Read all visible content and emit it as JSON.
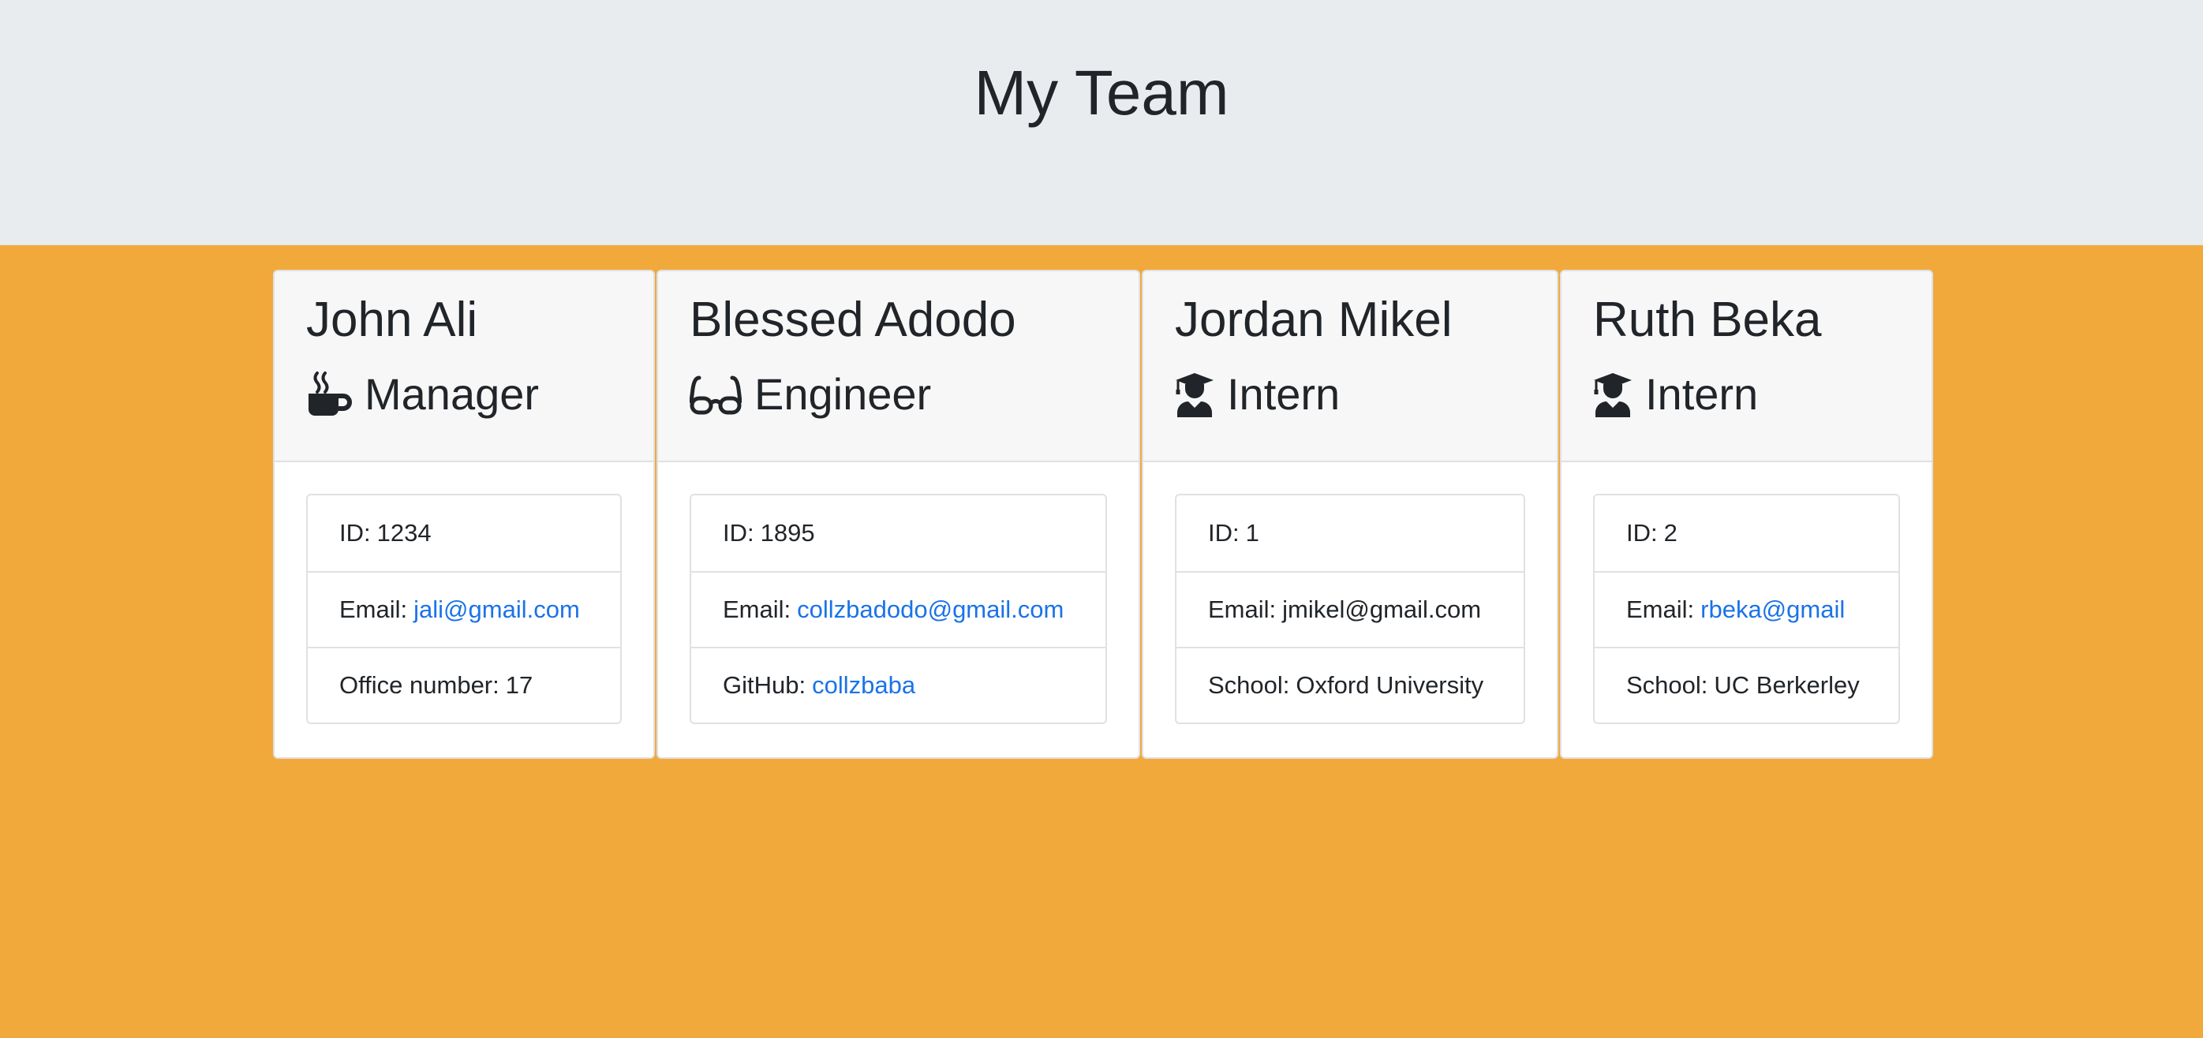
{
  "page": {
    "title": "My Team",
    "colors": {
      "header_bg": "#e9ecef",
      "body_bg": "#f2a93b",
      "link": "#1a73e8"
    }
  },
  "cards": [
    {
      "name": "John Ali",
      "role": "Manager",
      "role_icon": "coffee-mug-icon",
      "id_label": "ID:",
      "id_value": "1234",
      "email_label": "Email:",
      "email_value": "jali@gmail.com",
      "extra_label": "Office number:",
      "extra_value": "17"
    },
    {
      "name": "Blessed Adodo",
      "role": "Engineer",
      "role_icon": "glasses-icon",
      "id_label": "ID:",
      "id_value": "1895",
      "email_label": "Email:",
      "email_value": "collzbadodo@gmail.com",
      "extra_label": "GitHub:",
      "extra_value": "collzbaba"
    },
    {
      "name": "Jordan Mikel",
      "role": "Intern",
      "role_icon": "graduate-icon",
      "id_label": "ID:",
      "id_value": "1",
      "email_label": "Email:",
      "email_value": "jmikel@gmail.com",
      "extra_label": "School:",
      "extra_value": "Oxford University"
    },
    {
      "name": "Ruth Beka",
      "role": "Intern",
      "role_icon": "graduate-icon",
      "id_label": "ID:",
      "id_value": "2",
      "email_label": "Email:",
      "email_value": "rbeka@gmail",
      "extra_label": "School:",
      "extra_value": "UC Berkerley"
    }
  ]
}
